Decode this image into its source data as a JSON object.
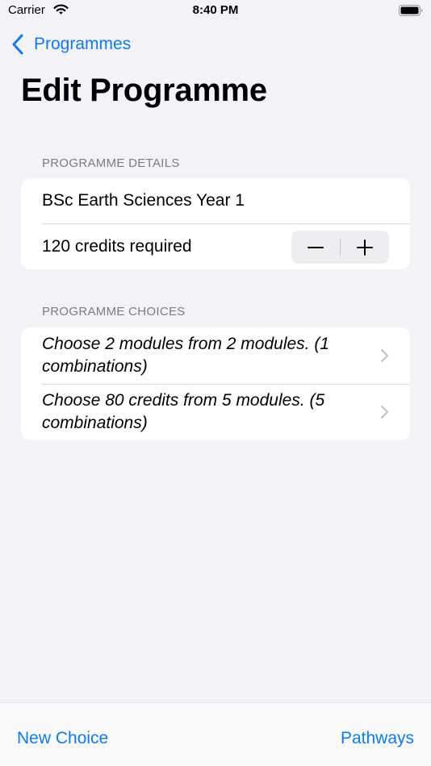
{
  "status_bar": {
    "carrier": "Carrier",
    "time": "8:40 PM"
  },
  "nav": {
    "back_label": "Programmes",
    "title": "Edit Programme"
  },
  "details": {
    "header": "PROGRAMME DETAILS",
    "name_value": "BSc Earth Sciences Year 1",
    "credits_text": "120 credits required"
  },
  "choices": {
    "header": "PROGRAMME CHOICES",
    "items": [
      {
        "label": "Choose 2 modules from 2 modules. (1 combinations)"
      },
      {
        "label": "Choose 80 credits from 5 modules. (5 combinations)"
      }
    ]
  },
  "toolbar": {
    "new_choice_label": "New Choice",
    "pathways_label": "Pathways"
  },
  "colors": {
    "accent": "#0a7aff",
    "background": "#f2f2f7",
    "card": "#ffffff",
    "secondary_text": "#7c7c81"
  },
  "icons": {
    "wifi": "wifi-icon",
    "battery": "battery-icon",
    "back": "chevron-left-icon",
    "disclosure": "chevron-right-icon",
    "minus": "minus-icon",
    "plus": "plus-icon"
  }
}
